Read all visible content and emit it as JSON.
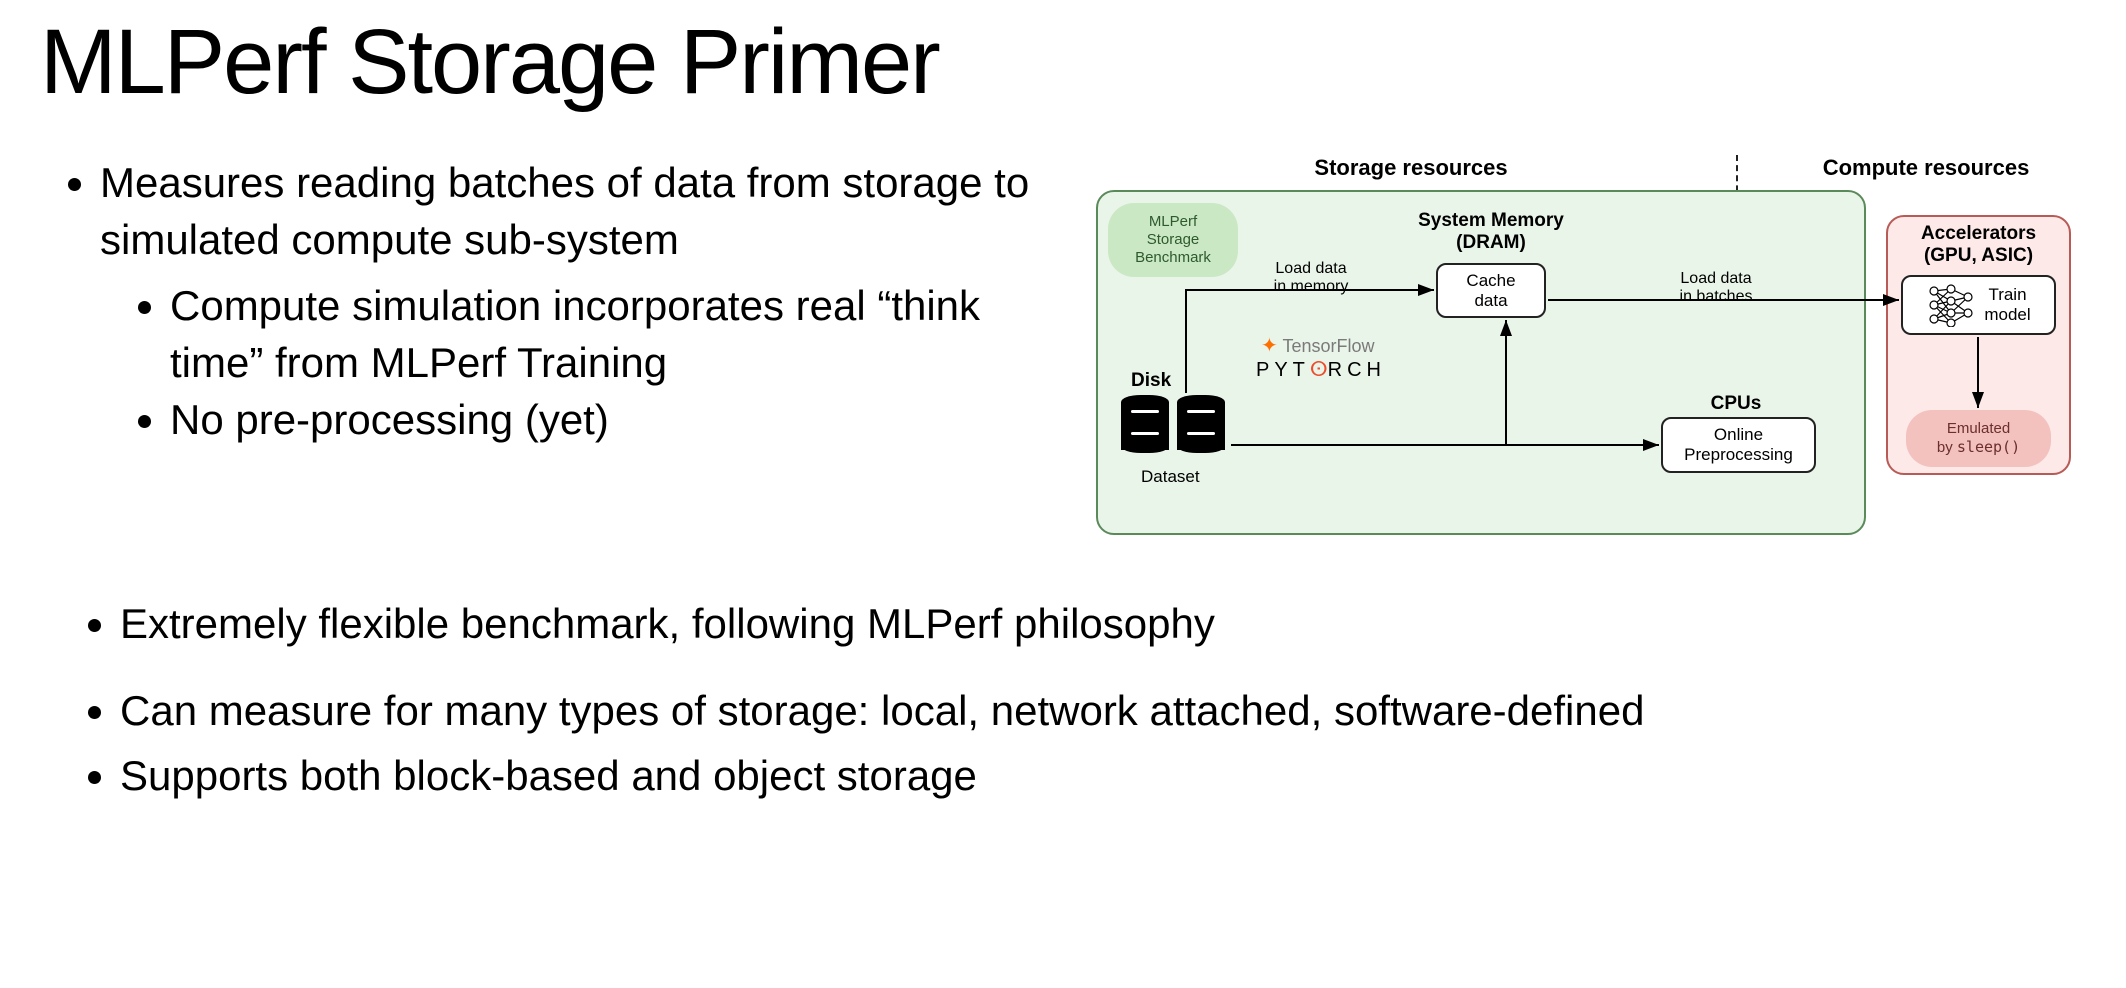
{
  "title": "MLPerf Storage Primer",
  "bullets_top": {
    "b1": "Measures reading batches of data from storage to simulated compute sub-system",
    "b1a": "Compute simulation incorporates real “think time” from MLPerf Training",
    "b1b": "No pre-processing (yet)"
  },
  "bullets_bottom": {
    "b2": "Extremely flexible benchmark, following MLPerf philosophy",
    "b3": "Can measure for many types of storage: local, network attached, software-defined",
    "b4": "Supports both block-based and object storage"
  },
  "diagram": {
    "zone_storage": "Storage resources",
    "zone_compute": "Compute resources",
    "badge_benchmark": "MLPerf Storage Benchmark",
    "section_memory_l1": "System Memory",
    "section_memory_l2": "(DRAM)",
    "section_accel_l1": "Accelerators",
    "section_accel_l2": "(GPU, ASIC)",
    "section_cpus": "CPUs",
    "disk_label": "Disk",
    "dataset_label": "Dataset",
    "node_cache_l1": "Cache",
    "node_cache_l2": "data",
    "node_preproc_l1": "Online",
    "node_preproc_l2": "Preprocessing",
    "node_train_l1": "Train",
    "node_train_l2": "model",
    "edge_load_mem_l1": "Load data",
    "edge_load_mem_l2": "in memory",
    "edge_load_batch_l1": "Load data",
    "edge_load_batch_l2": "in batches",
    "badge_emulated_l1": "Emulated",
    "badge_emulated_l2": "by ",
    "badge_emulated_code": "sleep()",
    "logo_tensorflow": "TensorFlow",
    "logo_pytorch_pre": "PYT",
    "logo_pytorch_post": "RCH"
  }
}
